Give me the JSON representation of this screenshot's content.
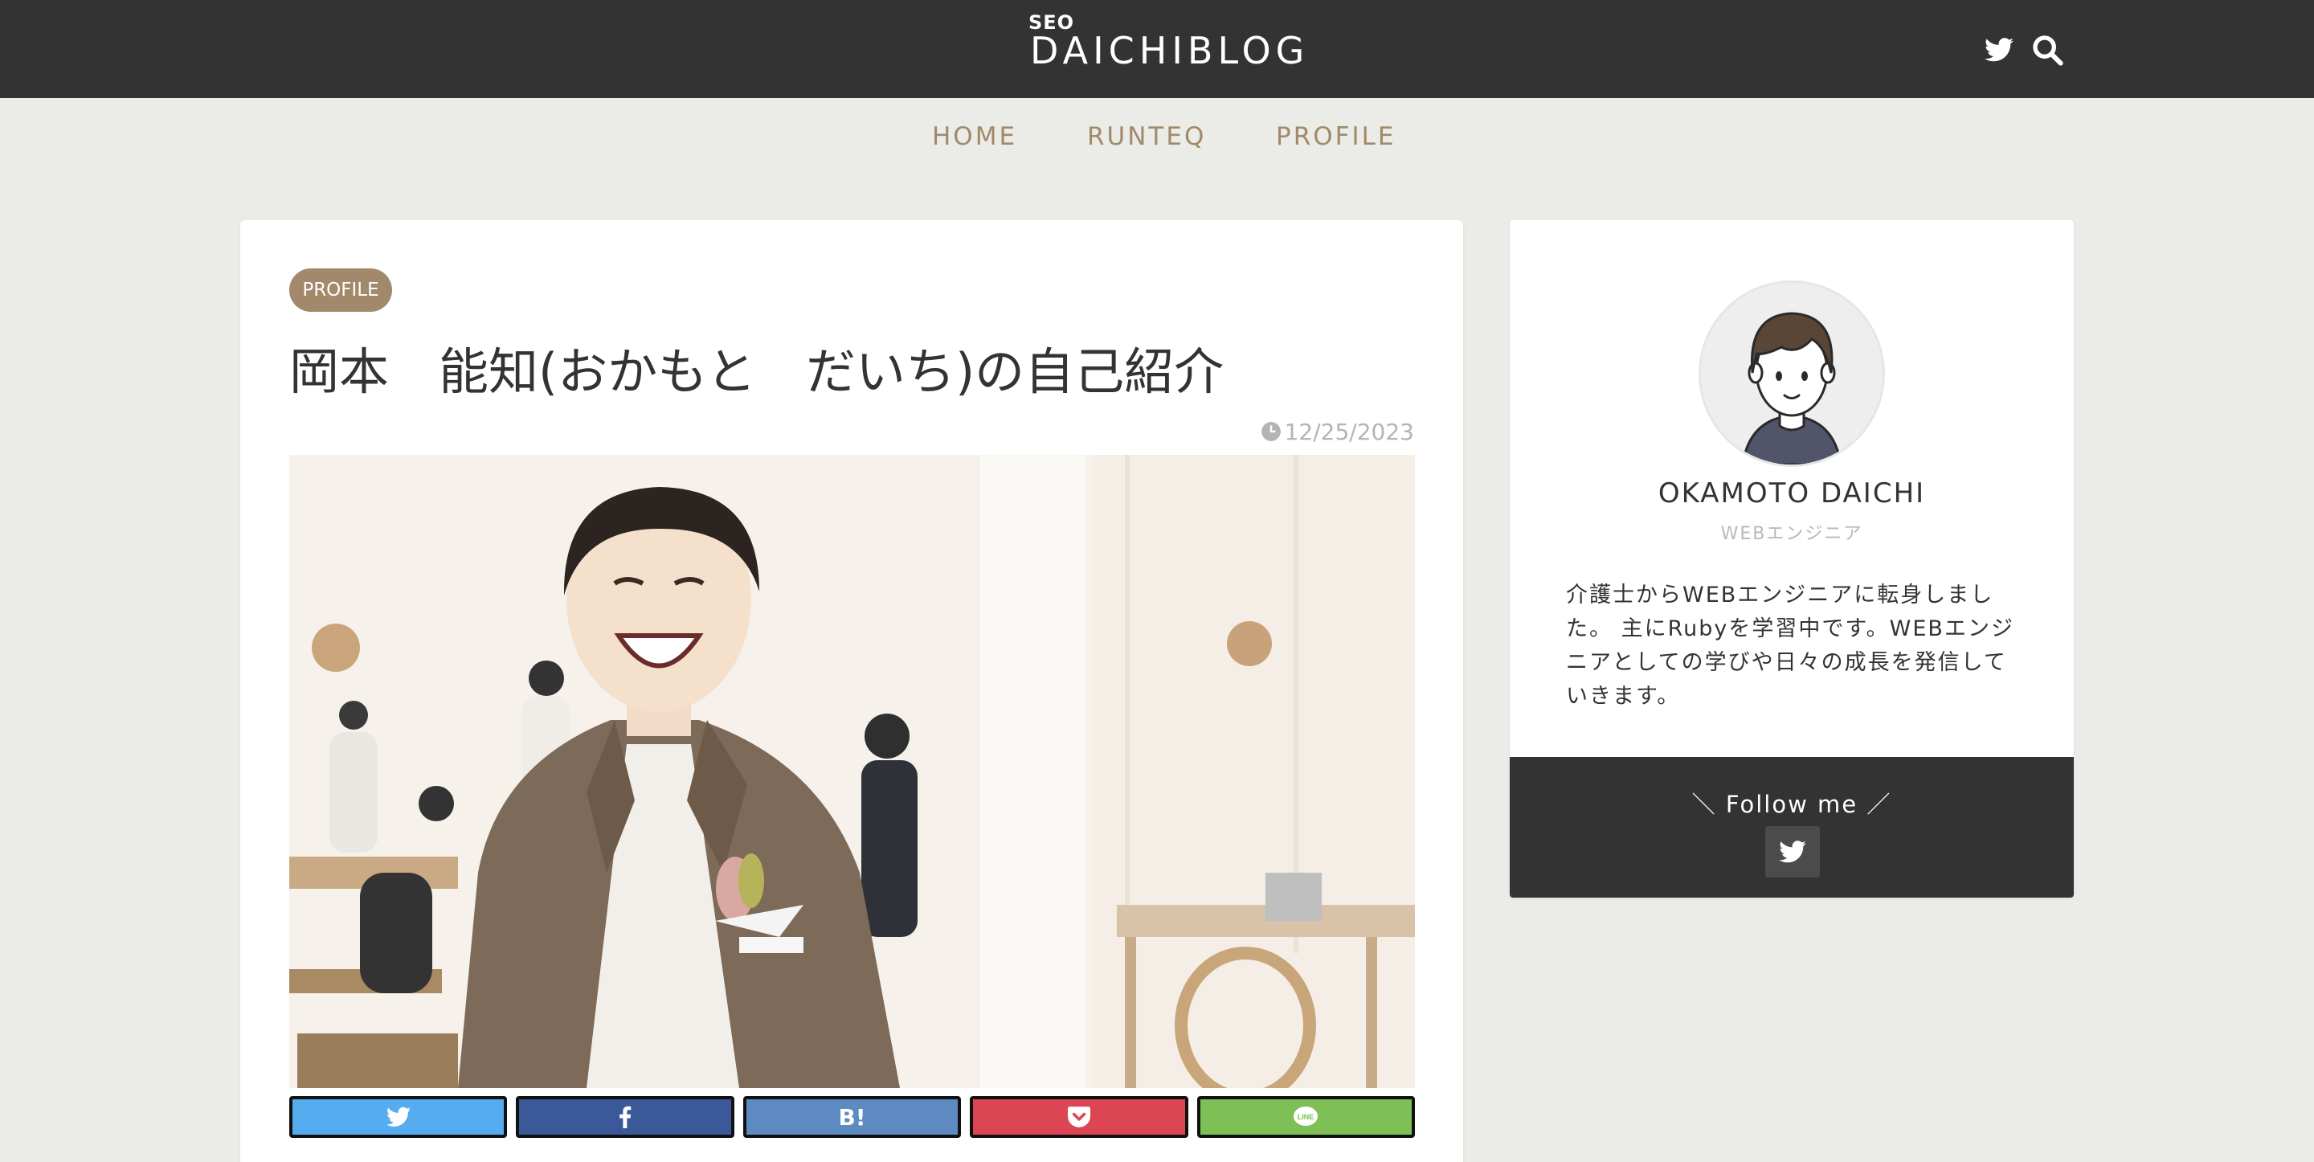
{
  "header": {
    "logo_small": "SEO",
    "logo_main": "DAICHIBLOG",
    "twitter_icon": "twitter-icon",
    "search_icon": "search-icon",
    "bg_color": "#333333"
  },
  "nav": {
    "items": [
      {
        "label": "HOME"
      },
      {
        "label": "RUNTEQ"
      },
      {
        "label": "PROFILE"
      }
    ],
    "color": "#a08a6a"
  },
  "article": {
    "category": "PROFILE",
    "title": "岡本　能知(おかもと　だいち)の自己紹介",
    "date_icon": "clock-icon",
    "date": "12/25/2023",
    "share_buttons": [
      {
        "name": "twitter",
        "icon": "twitter-icon",
        "color": "#55acee"
      },
      {
        "name": "facebook",
        "icon": "facebook-icon",
        "color": "#3b5998"
      },
      {
        "name": "hatena",
        "icon": "hatena-bookmark-icon",
        "label": "B!",
        "color": "#5d8ac1"
      },
      {
        "name": "pocket",
        "icon": "pocket-icon",
        "color": "#dc4654"
      },
      {
        "name": "line",
        "icon": "line-icon",
        "color": "#7ec055"
      }
    ]
  },
  "sidebar": {
    "profile": {
      "name": "OKAMOTO DAICHI",
      "role": "WEBエンジニア",
      "bio": "介護士からWEBエンジニアに転身しました。 主にRubyを学習中です。WEBエンジニアとしての学びや日々の成長を発信していきます。"
    },
    "follow": {
      "title": "＼ Follow me ／",
      "icon": "twitter-icon"
    }
  }
}
